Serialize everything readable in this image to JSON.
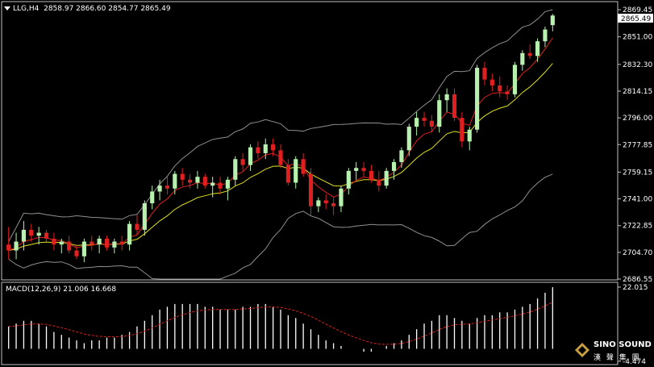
{
  "header": {
    "symbol": "LLG,H4",
    "ohlc": "2858.97 2866.60 2854.77 2865.49"
  },
  "price_axis": {
    "labels": [
      "2869.45",
      "2851.00",
      "2832.30",
      "2814.15",
      "2796.00",
      "2777.85",
      "2759.15",
      "2741.00",
      "2722.85",
      "2704.70",
      "2686.55"
    ],
    "current_price": "2865.49"
  },
  "macd": {
    "title": "MACD(12,26,9) 21.006 16.668",
    "top_label": "22.015",
    "bottom_label": "-4.474"
  },
  "brand": {
    "name": "SINO SOUND",
    "sub": "漢 聲 集 團"
  },
  "colors": {
    "background": "#000000",
    "bull": "#b8f0b0",
    "bear": "#e02020",
    "ma_fast": "#e02020",
    "ma_slow": "#e0e020",
    "bands": "#909090",
    "macd_hist": "#ffffff",
    "macd_signal": "#e02020"
  },
  "chart_data": {
    "type": "candlestick",
    "price_range": [
      2686.55,
      2869.45
    ],
    "candles": [
      [
        2710,
        2722,
        2700,
        2706
      ],
      [
        2706,
        2718,
        2700,
        2712
      ],
      [
        2712,
        2726,
        2706,
        2720
      ],
      [
        2720,
        2724,
        2712,
        2716
      ],
      [
        2716,
        2722,
        2710,
        2718
      ],
      [
        2718,
        2720,
        2712,
        2714
      ],
      [
        2714,
        2718,
        2706,
        2710
      ],
      [
        2710,
        2714,
        2704,
        2712
      ],
      [
        2712,
        2716,
        2704,
        2706
      ],
      [
        2706,
        2710,
        2700,
        2702
      ],
      [
        2702,
        2714,
        2698,
        2712
      ],
      [
        2712,
        2716,
        2706,
        2710
      ],
      [
        2710,
        2716,
        2704,
        2714
      ],
      [
        2714,
        2716,
        2706,
        2708
      ],
      [
        2708,
        2714,
        2704,
        2712
      ],
      [
        2712,
        2716,
        2706,
        2710
      ],
      [
        2710,
        2726,
        2706,
        2724
      ],
      [
        2724,
        2730,
        2716,
        2720
      ],
      [
        2720,
        2740,
        2716,
        2738
      ],
      [
        2738,
        2750,
        2734,
        2746
      ],
      [
        2746,
        2754,
        2740,
        2750
      ],
      [
        2750,
        2756,
        2744,
        2748
      ],
      [
        2748,
        2760,
        2744,
        2758
      ],
      [
        2758,
        2762,
        2750,
        2754
      ],
      [
        2754,
        2758,
        2748,
        2752
      ],
      [
        2752,
        2760,
        2748,
        2756
      ],
      [
        2756,
        2758,
        2748,
        2750
      ],
      [
        2750,
        2756,
        2742,
        2752
      ],
      [
        2752,
        2756,
        2744,
        2748
      ],
      [
        2748,
        2756,
        2740,
        2754
      ],
      [
        2754,
        2770,
        2750,
        2768
      ],
      [
        2768,
        2772,
        2760,
        2764
      ],
      [
        2764,
        2778,
        2760,
        2776
      ],
      [
        2776,
        2780,
        2768,
        2772
      ],
      [
        2772,
        2782,
        2768,
        2778
      ],
      [
        2778,
        2782,
        2770,
        2774
      ],
      [
        2774,
        2778,
        2762,
        2764
      ],
      [
        2764,
        2768,
        2750,
        2752
      ],
      [
        2752,
        2770,
        2748,
        2768
      ],
      [
        2768,
        2772,
        2756,
        2758
      ],
      [
        2758,
        2762,
        2730,
        2736
      ],
      [
        2736,
        2742,
        2732,
        2740
      ],
      [
        2740,
        2744,
        2734,
        2738
      ],
      [
        2738,
        2742,
        2730,
        2736
      ],
      [
        2736,
        2750,
        2732,
        2748
      ],
      [
        2748,
        2762,
        2744,
        2760
      ],
      [
        2760,
        2766,
        2754,
        2762
      ],
      [
        2762,
        2766,
        2756,
        2760
      ],
      [
        2760,
        2764,
        2752,
        2754
      ],
      [
        2754,
        2760,
        2746,
        2750
      ],
      [
        2750,
        2762,
        2748,
        2760
      ],
      [
        2760,
        2768,
        2754,
        2766
      ],
      [
        2766,
        2776,
        2762,
        2774
      ],
      [
        2774,
        2792,
        2770,
        2790
      ],
      [
        2790,
        2800,
        2784,
        2796
      ],
      [
        2796,
        2800,
        2790,
        2794
      ],
      [
        2794,
        2798,
        2786,
        2790
      ],
      [
        2790,
        2812,
        2786,
        2808
      ],
      [
        2808,
        2816,
        2800,
        2812
      ],
      [
        2812,
        2816,
        2794,
        2796
      ],
      [
        2796,
        2800,
        2776,
        2780
      ],
      [
        2780,
        2790,
        2774,
        2788
      ],
      [
        2788,
        2832,
        2786,
        2830
      ],
      [
        2830,
        2834,
        2818,
        2822
      ],
      [
        2822,
        2826,
        2814,
        2818
      ],
      [
        2818,
        2824,
        2810,
        2814
      ],
      [
        2814,
        2818,
        2808,
        2812
      ],
      [
        2812,
        2834,
        2810,
        2832
      ],
      [
        2832,
        2842,
        2828,
        2840
      ],
      [
        2840,
        2846,
        2836,
        2838
      ],
      [
        2838,
        2850,
        2834,
        2848
      ],
      [
        2848,
        2858,
        2844,
        2856
      ],
      [
        2858.97,
        2866.6,
        2854.77,
        2865.49
      ]
    ],
    "macd_hist": [
      8,
      9,
      10,
      10,
      9,
      8,
      6,
      5,
      4,
      3,
      2,
      3,
      3,
      4,
      4,
      5,
      6,
      8,
      10,
      12,
      14,
      15,
      16,
      16,
      16,
      16,
      15,
      15,
      14,
      14,
      14,
      15,
      15,
      16,
      16,
      15,
      14,
      12,
      11,
      9,
      7,
      5,
      3,
      2,
      1,
      0,
      0,
      -1,
      -1,
      0,
      1,
      2,
      3,
      5,
      7,
      9,
      10,
      12,
      12,
      11,
      10,
      9,
      11,
      12,
      12,
      13,
      13,
      14,
      15,
      16,
      18,
      20,
      22
    ]
  }
}
